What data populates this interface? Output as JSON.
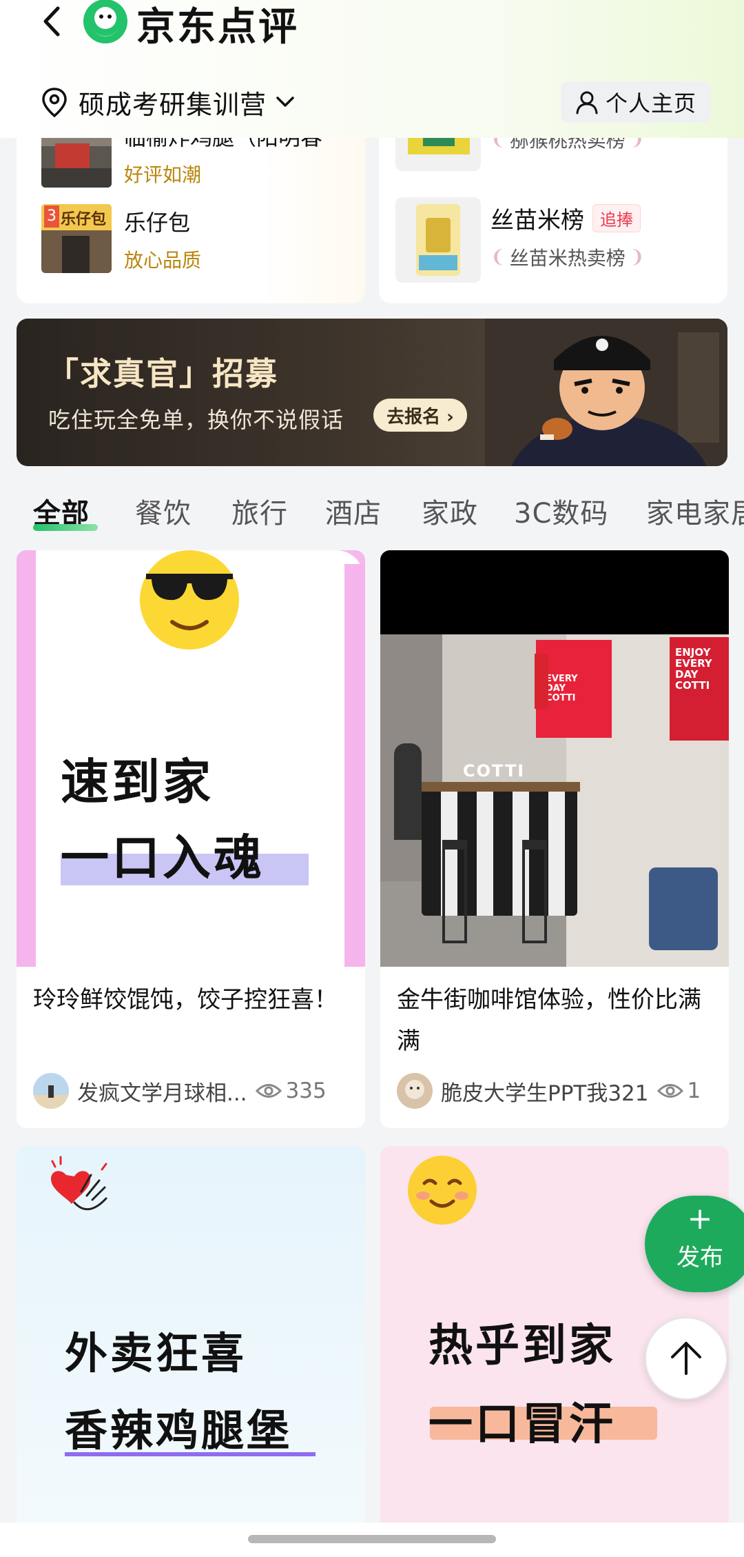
{
  "header": {
    "brand": "京东点评",
    "location": "硕成考研集训营",
    "profile": "个人主页"
  },
  "rank_left": {
    "items": [
      {
        "name": "临榆炸鸡腿（阳明春",
        "tag": "好评如潮"
      },
      {
        "name": "乐仔包",
        "tag": "放心品质",
        "thumb_label": "乐仔包",
        "thumb_rank": "3"
      }
    ]
  },
  "rank_right": {
    "items": [
      {
        "name": "",
        "laurel": "猕猴桃热卖榜"
      },
      {
        "name": "丝苗米榜",
        "badge": "追捧",
        "laurel": "丝苗米热卖榜"
      }
    ]
  },
  "banner": {
    "title": "「求真官」招募",
    "subtitle": "吃住玩全免单，换你不说假话",
    "cta": "去报名 ›"
  },
  "tabs": [
    "全部",
    "餐饮",
    "旅行",
    "酒店",
    "家政",
    "3C数码",
    "家电家居"
  ],
  "feed": [
    {
      "title": "玲玲鲜饺馄饨，饺子控狂喜！",
      "author": "发疯文学月球相...",
      "views": "335",
      "line1": "速到家",
      "line2": "一口入魂"
    },
    {
      "title": "金牛街咖啡馆体验，性价比满满",
      "author": "脆皮大学生PPT我321",
      "views": "1",
      "sign1": "EVERY DAY COTTI",
      "sign2": "ENJOY EVERY DAY COTTI",
      "counter": "COTTI"
    },
    {
      "line1": "外卖狂喜",
      "line2": "香辣鸡腿堡"
    },
    {
      "line1": "热乎到家",
      "line2": "一口冒汗"
    }
  ],
  "fab": {
    "plus": "+",
    "label": "发布"
  },
  "colors": {
    "brand_green": "#1eaa5c",
    "tag_gold": "#b8860b",
    "badge_red": "#e8384f"
  }
}
